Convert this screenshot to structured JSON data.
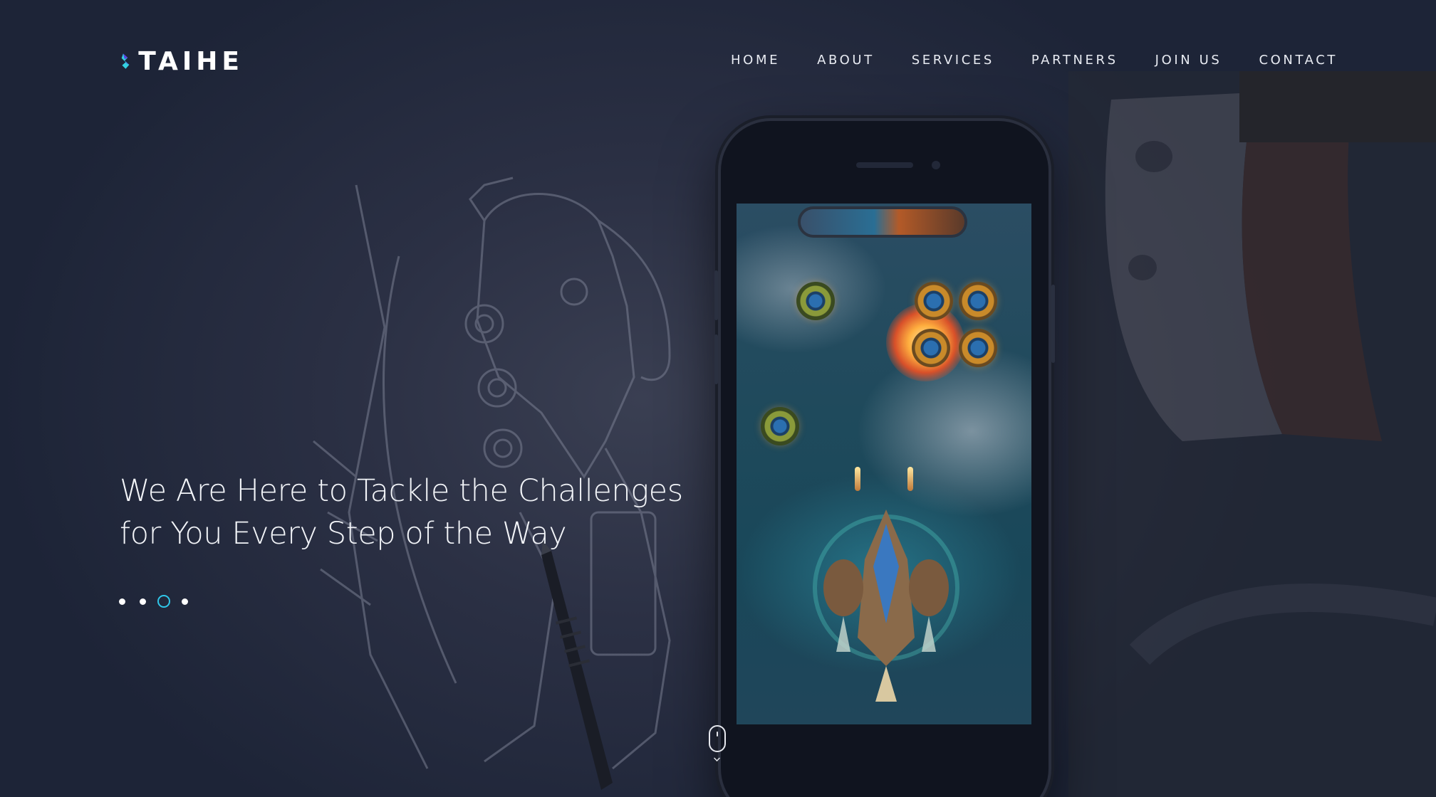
{
  "brand": {
    "name": "TAIHE",
    "logo_text": "TAIHE",
    "colors": {
      "accent": "#2fc6e8",
      "logo_primary": "#33d0e0",
      "logo_secondary": "#5a3ee0"
    }
  },
  "nav": {
    "items": [
      {
        "label": "HOME"
      },
      {
        "label": "ABOUT"
      },
      {
        "label": "SERVICES"
      },
      {
        "label": "PARTNERS"
      },
      {
        "label": "JOIN US"
      },
      {
        "label": "CONTACT"
      }
    ]
  },
  "hero": {
    "headline_line1": "We Are Here to Tackle the Challenges",
    "headline_line2": "for You Every Step of the Way",
    "slider": {
      "total_slides": 4,
      "active_index": 2
    },
    "scroll_indicator": "mouse-scroll-icon"
  }
}
